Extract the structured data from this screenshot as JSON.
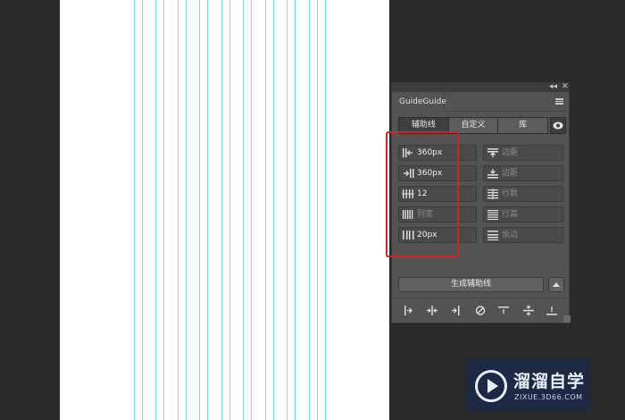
{
  "panel": {
    "top_icons": "◂◂  ✕",
    "title": "GuideGuide",
    "tabs": [
      "辅助线",
      "自定义",
      "库"
    ],
    "left_fields": [
      {
        "icon": "left-margin-icon",
        "value": "360px",
        "placeholder": ""
      },
      {
        "icon": "right-margin-icon",
        "value": "360px",
        "placeholder": ""
      },
      {
        "icon": "columns-count-icon",
        "value": "12",
        "placeholder": ""
      },
      {
        "icon": "column-width-icon",
        "value": "",
        "placeholder": "列宽"
      },
      {
        "icon": "gutter-icon",
        "value": "20px",
        "placeholder": ""
      }
    ],
    "right_fields": [
      {
        "icon": "top-margin-icon",
        "value": "",
        "placeholder": "边距"
      },
      {
        "icon": "bottom-margin-icon",
        "value": "",
        "placeholder": "边距"
      },
      {
        "icon": "rows-count-icon",
        "value": "",
        "placeholder": "行数"
      },
      {
        "icon": "row-height-icon",
        "value": "",
        "placeholder": "行高"
      },
      {
        "icon": "row-gutter-icon",
        "value": "",
        "placeholder": "余边"
      }
    ],
    "generate_button": "生成辅助线"
  },
  "watermark": {
    "name": "溜溜自学",
    "url": "ZIXUE.3D66.COM"
  },
  "colors": {
    "guide_line": "#7fdde8",
    "highlight": "#d3241f",
    "panel_bg": "#535353",
    "workspace": "#2a2a2a"
  }
}
